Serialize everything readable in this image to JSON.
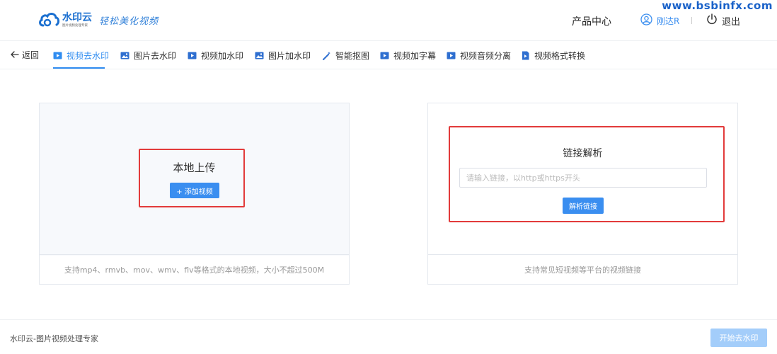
{
  "header": {
    "logo_name": "水印云",
    "logo_sub": "图片视频处理专家",
    "slogan": "轻松美化视频",
    "watermark": "www.bsbinfx.com",
    "product_center": "产品中心",
    "username": "刚达R",
    "logout": "退出"
  },
  "tabs": {
    "back": "返回",
    "items": [
      {
        "label": "视频去水印",
        "icon": "video-icon",
        "active": true
      },
      {
        "label": "图片去水印",
        "icon": "image-icon",
        "active": false
      },
      {
        "label": "视频加水印",
        "icon": "video-icon",
        "active": false
      },
      {
        "label": "图片加水印",
        "icon": "image-icon",
        "active": false
      },
      {
        "label": "智能抠图",
        "icon": "magic-wand-icon",
        "active": false
      },
      {
        "label": "视频加字幕",
        "icon": "video-icon",
        "active": false
      },
      {
        "label": "视频音频分离",
        "icon": "video-icon",
        "active": false
      },
      {
        "label": "视频格式转换",
        "icon": "file-video-icon",
        "active": false
      }
    ]
  },
  "local_upload": {
    "title": "本地上传",
    "button": "+ 添加视频",
    "hint": "支持mp4、rmvb、mov、wmv、flv等格式的本地视频，大小不超过500M"
  },
  "link_parse": {
    "title": "链接解析",
    "placeholder": "请输入链接，以http或https开头",
    "button": "解析链接",
    "hint": "支持常见短视频等平台的视频链接"
  },
  "footer": {
    "text": "水印云-图片视频处理专家",
    "start_button": "开始去水印"
  },
  "colors": {
    "accent": "#3a8ef0",
    "highlight_box": "#e23b3b",
    "disabled_button": "#a3cdfa"
  }
}
